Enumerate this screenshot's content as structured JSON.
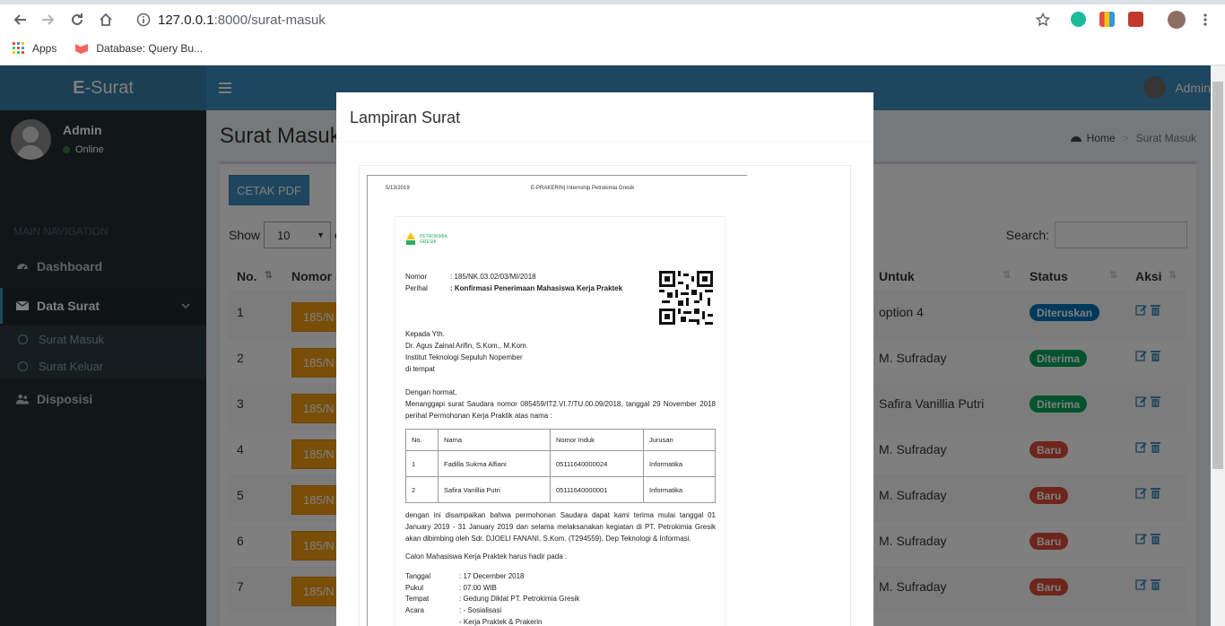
{
  "browser": {
    "url_host": "127.0.0.1",
    "url_path": ":8000/surat-masuk",
    "bookmarks": [
      "Apps",
      "Database: Query Bu..."
    ]
  },
  "app": {
    "logo_bold": "E",
    "logo_text": "-Surat",
    "top_user": "Admin",
    "user_name": "Admin",
    "user_status": "Online",
    "nav_header": "MAIN NAVIGATION",
    "menu": {
      "dashboard": "Dashboard",
      "data_surat": "Data Surat",
      "surat_masuk": "Surat Masuk",
      "surat_keluar": "Surat Keluar",
      "disposisi": "Disposisi"
    },
    "page_title": "Surat Masuk",
    "breadcrumb_home": "Home",
    "breadcrumb_current": "Surat Masuk",
    "cetak_pdf": "CETAK PDF",
    "show_label": "Show",
    "show_value": "10",
    "entries_partial": "e",
    "search_label": "Search:",
    "columns": {
      "no": "No.",
      "nomor": "Nomor S",
      "untuk": "Untuk",
      "status": "Status",
      "aksi": "Aksi"
    },
    "rows": [
      {
        "no": "1",
        "nomor": "185/N",
        "untuk": "option 4",
        "status": "Diteruskan"
      },
      {
        "no": "2",
        "nomor": "185/N",
        "untuk": "M. Sufraday",
        "status": "Diterima"
      },
      {
        "no": "3",
        "nomor": "185/N",
        "untuk": "Safira Vanillia Putri",
        "status": "Diterima"
      },
      {
        "no": "4",
        "nomor": "185/N",
        "untuk": "M. Sufraday",
        "status": "Baru"
      },
      {
        "no": "5",
        "nomor": "185/N",
        "untuk": "M. Sufraday",
        "status": "Baru"
      },
      {
        "no": "6",
        "nomor": "185/N",
        "untuk": "M. Sufraday",
        "status": "Baru"
      },
      {
        "no": "7",
        "nomor": "185/N",
        "untuk": "M. Sufraday",
        "status": "Baru"
      }
    ],
    "status_colors": {
      "Diteruskan": "#0073b7",
      "Diterima": "#00a65a",
      "Baru": "#dd4b39"
    }
  },
  "modal": {
    "title": "Lampiran Surat",
    "doc": {
      "date": "5/13/2019",
      "header_title": "E-PRAKERIN| Internship Petrokimia Gresik",
      "company_logo_text": "PETROKIMIA GRESIK",
      "nomor_label": "Nomor",
      "nomor_value": ": 185/NK.03.02/03/MI/2018",
      "perihal_label": "Perihal",
      "perihal_value": ": Konfirmasi Penerimaan Mahasiswa Kerja Praktek",
      "kepada": "Kepada Yth.",
      "recipient": "Dr. Agus Zainal Arifin, S.Kom., M.Kom.",
      "institution": "Institut Teknologi Sepuluh Nopember",
      "place": "di tempat",
      "greeting": "Dengan hormat,",
      "intro": "Menanggapi surat Saudara nomor 085459/IT2.VI.7/TU.00.09/2018, tanggal 29 November 2018 perihal Permohonan Kerja Praktik atas nama :",
      "table_head": [
        "No.",
        "Nama",
        "Nomor Induk",
        "Jurusan"
      ],
      "table_rows": [
        [
          "1",
          "Fadilla Sukma Alfiani",
          "05111640000024",
          "Informatika"
        ],
        [
          "2",
          "Safira Vanillia Putri",
          "05111640000001",
          "Informatika"
        ]
      ],
      "body": "dengan ini disampaikan bahwa permohonan Saudara dapat kami terima mulai tanggal 01 January 2019 - 31 January 2019 dan selama melaksanakan kegiatan di PT. Petrokimia Gresik akan dibimbing oleh Sdr. DJOELI FANANI, S.Kom. (T294559), Dep Teknologi & Informasi.",
      "calon": "Calon Mahasiswa Kerja Praktek harus hadir pada :",
      "tanggal_label": "Tanggal",
      "tanggal_value": ": 17 December 2018",
      "pukul_label": "Pukul",
      "pukul_value": ": 07:00 WIB",
      "tempat_label": "Tempat",
      "tempat_value": ": Gedung Diklat PT. Petrokimia Gresik",
      "acara_label": "Acara",
      "acara_value": ": - Sosialisasi",
      "acara_value2": "- Kerja Praktek & Prakerin"
    }
  }
}
